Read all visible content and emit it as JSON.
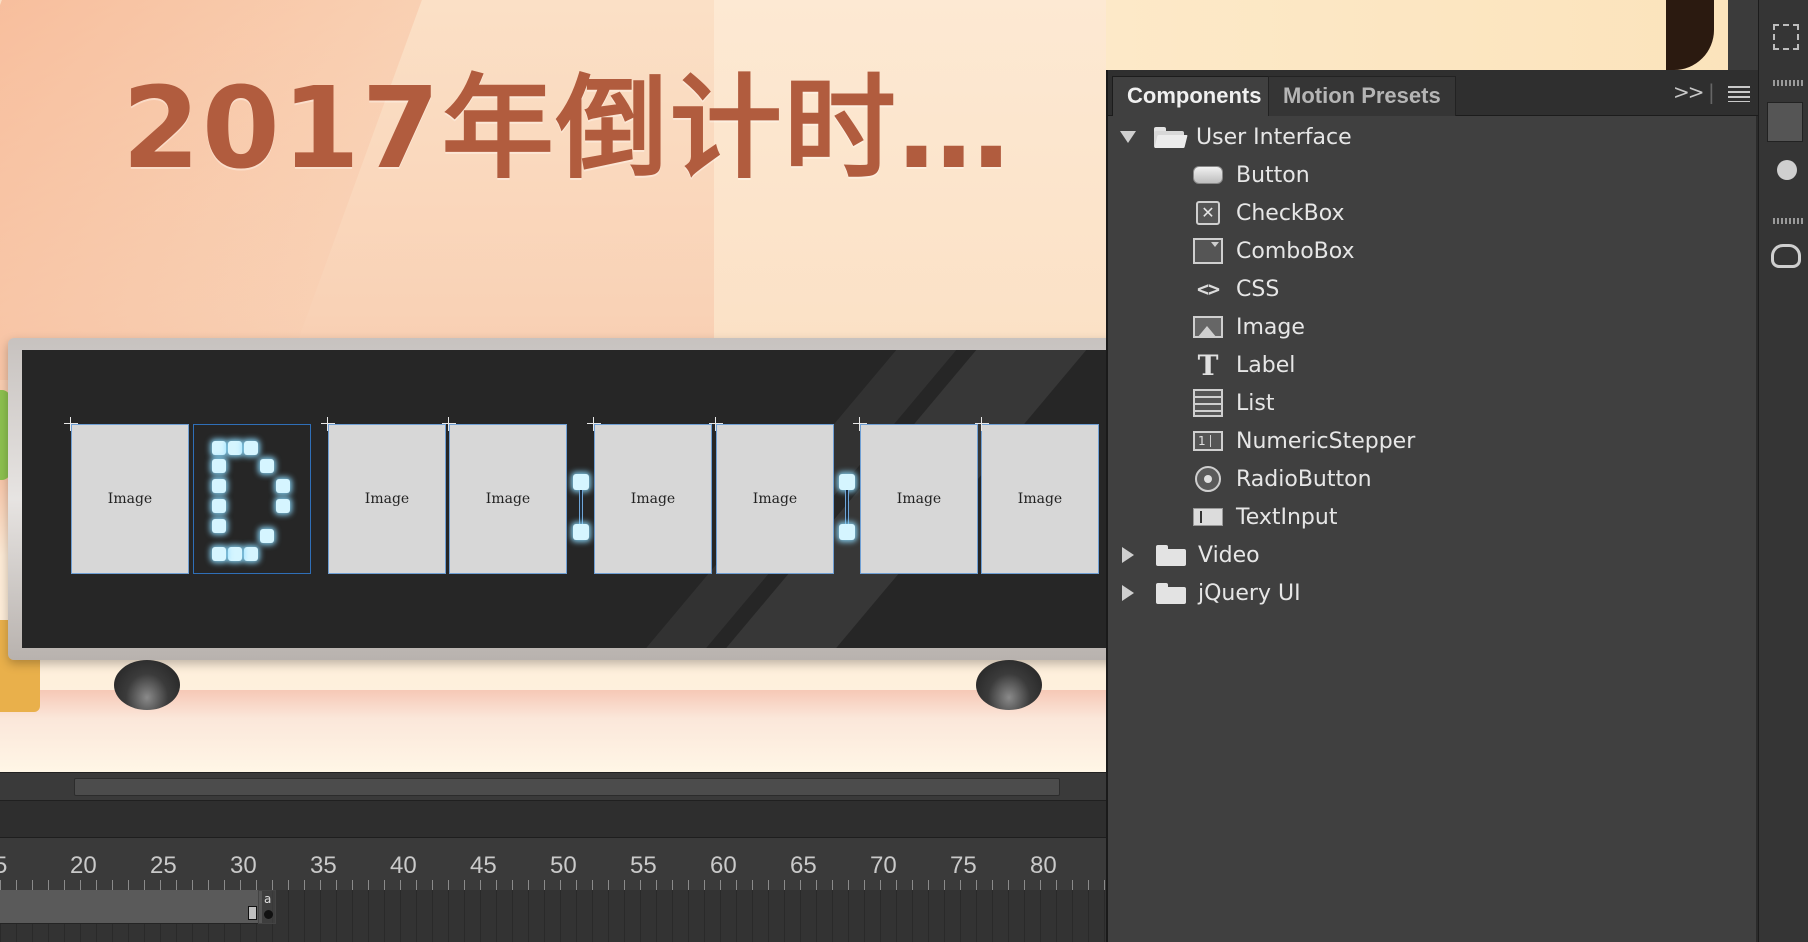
{
  "stage": {
    "title": "2017年倒计时…",
    "digit_placeholder": "Image",
    "scroll": {}
  },
  "timeline": {
    "ruler_labels": [
      "5",
      "20",
      "25",
      "30",
      "35",
      "40",
      "45",
      "50",
      "55",
      "60",
      "65",
      "70",
      "75",
      "80"
    ],
    "keyframe_marker": "a"
  },
  "panel": {
    "tabs": [
      {
        "label": "Components",
        "active": true
      },
      {
        "label": "Motion Presets",
        "active": false
      }
    ],
    "expand_label": ">>",
    "tree": [
      {
        "label": "User Interface",
        "expanded": true,
        "children": [
          {
            "label": "Button",
            "icon": "button-icon"
          },
          {
            "label": "CheckBox",
            "icon": "checkbox-icon"
          },
          {
            "label": "ComboBox",
            "icon": "combobox-icon"
          },
          {
            "label": "CSS",
            "icon": "css-icon"
          },
          {
            "label": "Image",
            "icon": "image-icon"
          },
          {
            "label": "Label",
            "icon": "label-icon"
          },
          {
            "label": "List",
            "icon": "list-icon"
          },
          {
            "label": "NumericStepper",
            "icon": "numeric-stepper-icon"
          },
          {
            "label": "RadioButton",
            "icon": "radio-button-icon"
          },
          {
            "label": "TextInput",
            "icon": "text-input-icon"
          }
        ]
      },
      {
        "label": "Video",
        "expanded": false
      },
      {
        "label": "jQuery UI",
        "expanded": false
      }
    ],
    "icon_glyphs": {
      "checkbox": "✕",
      "css": "<>",
      "label": "T",
      "stepper": "1"
    }
  },
  "colors": {
    "title": "#b15c3e",
    "panel_bg": "#404040",
    "led": "#d5f5ff"
  }
}
